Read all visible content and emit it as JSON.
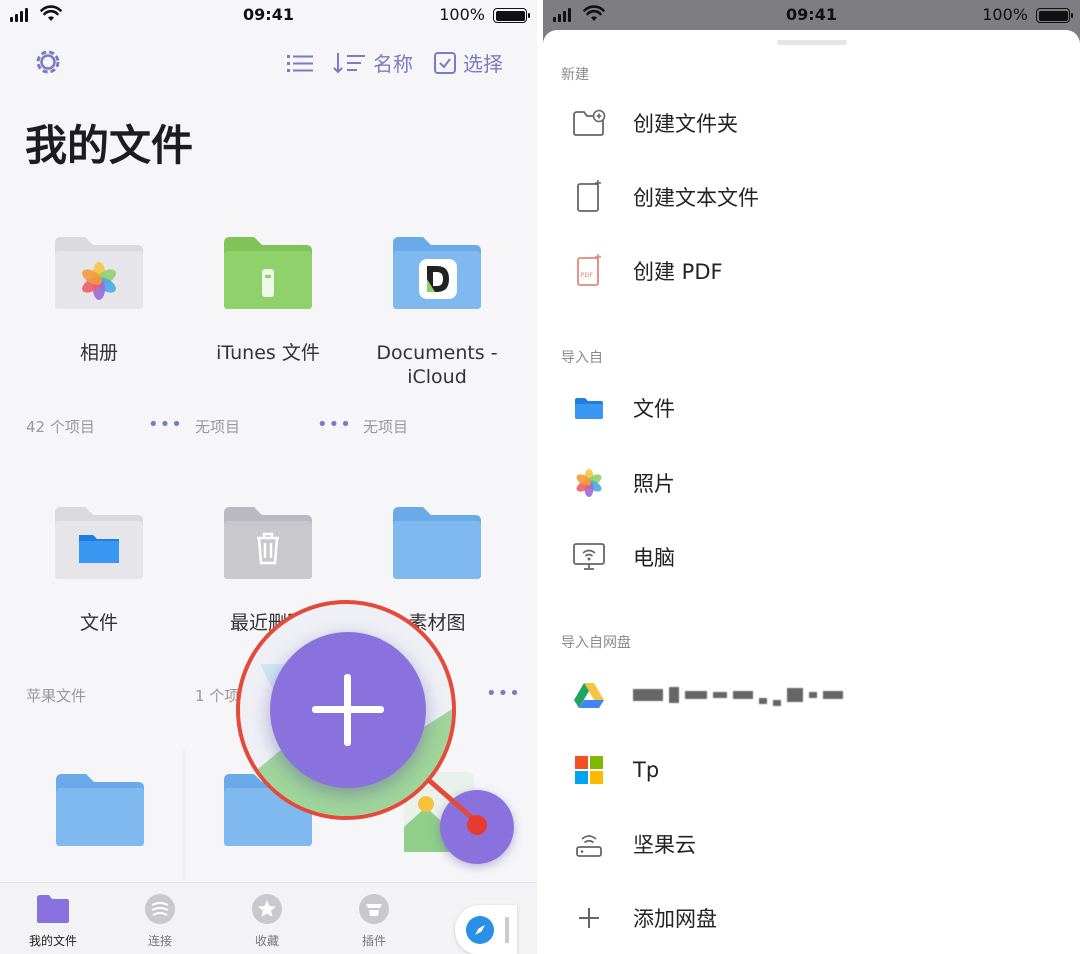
{
  "status": {
    "time": "09:41",
    "battery": "100%"
  },
  "header": {
    "sort_label": "名称",
    "select_label": "选择",
    "title": "我的文件"
  },
  "folders": [
    {
      "label": "相册",
      "meta": "42 个项目"
    },
    {
      "label": "iTunes 文件",
      "meta": "无项目"
    },
    {
      "label": "Documents - iCloud",
      "meta": "无项目"
    },
    {
      "label": "文件",
      "meta": "苹果文件"
    },
    {
      "label": "最近删除",
      "meta": "1 个项目"
    },
    {
      "label": "素材图",
      "meta": ""
    }
  ],
  "tabs": [
    "我的文件",
    "连接",
    "收藏",
    "插件"
  ],
  "sheet": {
    "section_new": "新建",
    "new_items": [
      "创建文件夹",
      "创建文本文件",
      "创建 PDF"
    ],
    "section_import": "导入自",
    "import_items": [
      "文件",
      "照片",
      "电脑"
    ],
    "section_cloud": "导入自网盘",
    "cloud_items": [
      "Tp",
      "坚果云",
      "添加网盘"
    ]
  },
  "colors": {
    "accent": "#8a72de",
    "icon_tint": "#7b7bc4",
    "highlight_ring": "#e34a3a",
    "folder_blue": "#7fb9f0",
    "folder_green": "#8fd16a",
    "folder_gray": "#d9d9de"
  },
  "icons": {
    "settings": "gear-icon",
    "list": "list-icon",
    "sort": "sort-icon",
    "select": "checkbox-icon"
  }
}
